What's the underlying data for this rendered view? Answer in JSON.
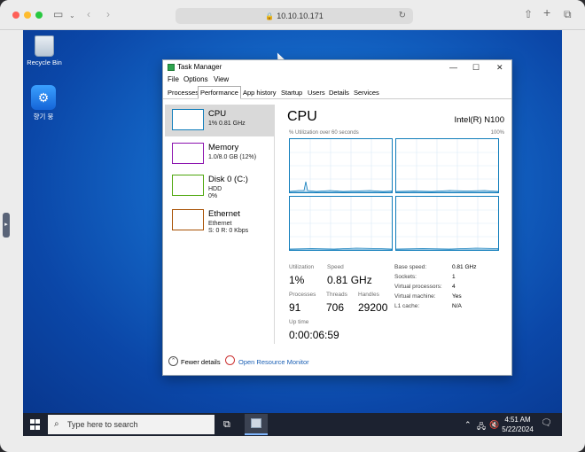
{
  "safari": {
    "url": "10.10.10.171"
  },
  "desktop": {
    "icons": [
      {
        "label": "Recycle Bin"
      },
      {
        "label": "향기 뭉"
      }
    ]
  },
  "taskbar": {
    "search_placeholder": "Type here to search",
    "time": "4:51 AM",
    "date": "5/22/2024"
  },
  "task_manager": {
    "title": "Task Manager",
    "menu": [
      "File",
      "Options",
      "View"
    ],
    "tabs": [
      "Processes",
      "Performance",
      "App history",
      "Startup",
      "Users",
      "Details",
      "Services"
    ],
    "active_tab": "Performance",
    "sidebar": [
      {
        "name": "CPU",
        "sub1": "1% 0.81 GHz",
        "sub2": "",
        "sub3": "",
        "color": "#117dbb"
      },
      {
        "name": "Memory",
        "sub1": "1.0/8.0 GB (12%)",
        "sub2": "",
        "sub3": "",
        "color": "#8b12ae"
      },
      {
        "name": "Disk 0 (C:)",
        "sub1": "HDD",
        "sub2": "0%",
        "sub3": "",
        "color": "#4da60c"
      },
      {
        "name": "Ethernet",
        "sub1": "Ethernet",
        "sub2": "S: 0 R: 0 Kbps",
        "sub3": "",
        "color": "#a74f01"
      }
    ],
    "cpu": {
      "heading": "CPU",
      "model": "Intel(R) N100",
      "util_caption": "% Utilization over 60 seconds",
      "max_label": "100%",
      "utilization_label": "Utilization",
      "utilization": "1%",
      "speed_label": "Speed",
      "speed": "0.81 GHz",
      "processes_label": "Processes",
      "processes": "91",
      "threads_label": "Threads",
      "threads": "706",
      "handles_label": "Handles",
      "handles": "29200",
      "uptime_label": "Up time",
      "uptime": "0:00:06:59",
      "details": [
        {
          "label": "Base speed:",
          "value": "0.81 GHz"
        },
        {
          "label": "Sockets:",
          "value": "1"
        },
        {
          "label": "Virtual processors:",
          "value": "4"
        },
        {
          "label": "Virtual machine:",
          "value": "Yes"
        },
        {
          "label": "L1 cache:",
          "value": "N/A"
        }
      ]
    },
    "footer": {
      "fewer_details": "Fewer details",
      "resource_monitor": "Open Resource Monitor"
    }
  }
}
